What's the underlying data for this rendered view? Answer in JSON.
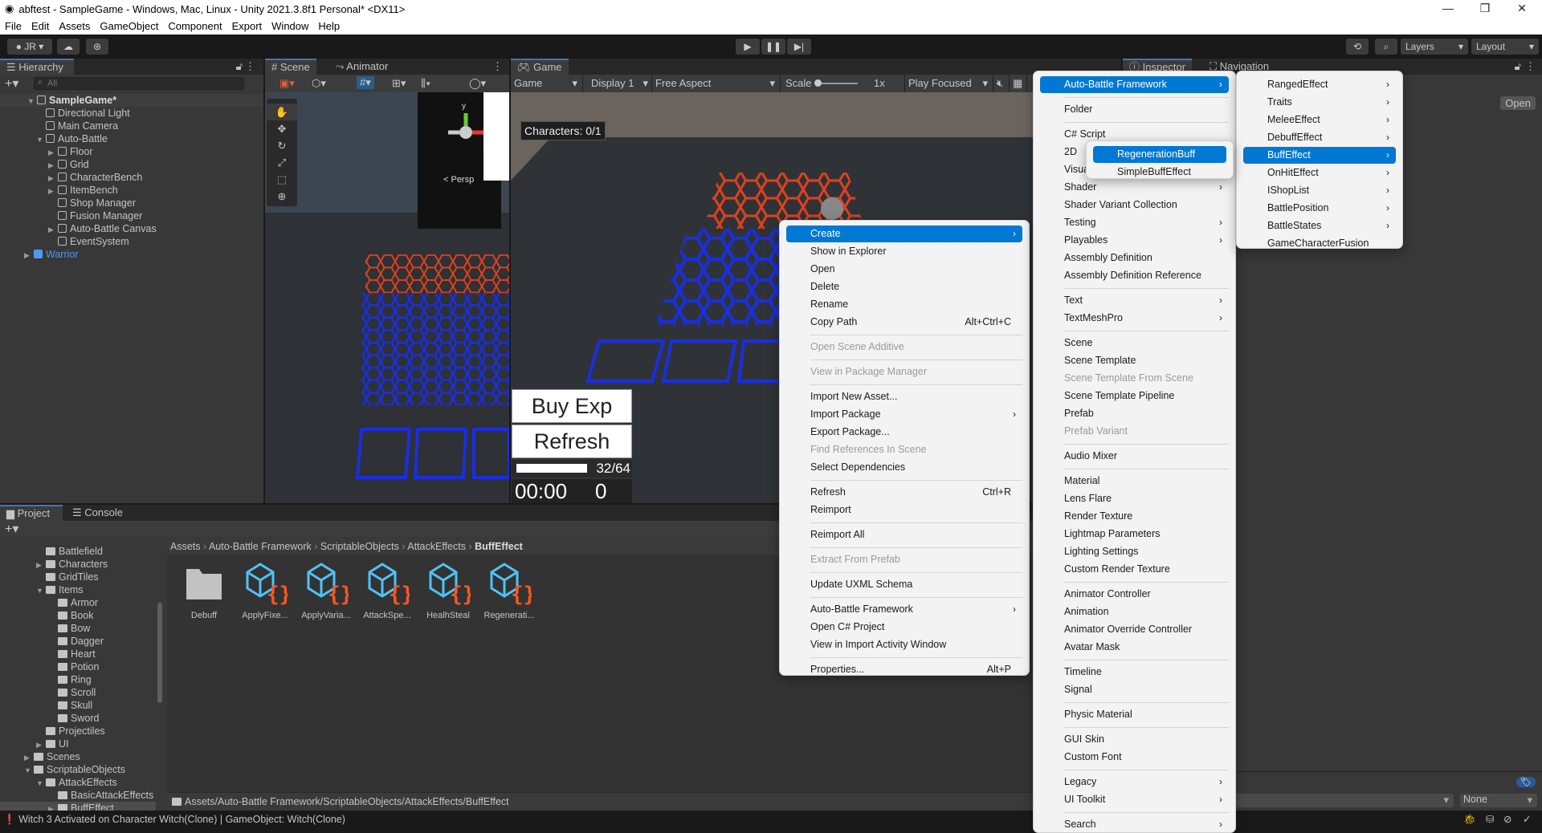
{
  "window": {
    "title": "abftest - SampleGame - Windows, Mac, Linux - Unity 2021.3.8f1 Personal* <DX11>"
  },
  "menubar": [
    "File",
    "Edit",
    "Assets",
    "GameObject",
    "Component",
    "Export",
    "Window",
    "Help"
  ],
  "toolbar": {
    "account": "JR",
    "layers": "Layers",
    "layout": "Layout"
  },
  "hierarchy": {
    "tab": "Hierarchy",
    "search_placeholder": "All",
    "items": [
      {
        "label": "SampleGame*",
        "depth": 0,
        "expanded": true,
        "type": "scene"
      },
      {
        "label": "Directional Light",
        "depth": 1,
        "type": "object"
      },
      {
        "label": "Main Camera",
        "depth": 1,
        "type": "object"
      },
      {
        "label": "Auto-Battle",
        "depth": 1,
        "expanded": true,
        "type": "object"
      },
      {
        "label": "Floor",
        "depth": 2,
        "collapsed": true,
        "type": "object"
      },
      {
        "label": "Grid",
        "depth": 2,
        "collapsed": true,
        "type": "object"
      },
      {
        "label": "CharacterBench",
        "depth": 2,
        "collapsed": true,
        "type": "object"
      },
      {
        "label": "ItemBench",
        "depth": 2,
        "collapsed": true,
        "type": "object"
      },
      {
        "label": "Shop Manager",
        "depth": 2,
        "type": "object"
      },
      {
        "label": "Fusion Manager",
        "depth": 2,
        "type": "object"
      },
      {
        "label": "Auto-Battle Canvas",
        "depth": 2,
        "collapsed": true,
        "type": "object"
      },
      {
        "label": "EventSystem",
        "depth": 2,
        "type": "object"
      },
      {
        "label": "Warrior",
        "depth": 0,
        "collapsed": true,
        "type": "prefab"
      }
    ]
  },
  "scene": {
    "tab_scene": "Scene",
    "tab_animator": "Animator",
    "persp": "< Persp",
    "axis_y": "y"
  },
  "game": {
    "tab": "Game",
    "mode": "Game",
    "display": "Display 1",
    "aspect": "Free Aspect",
    "scale_label": "Scale",
    "scale_value": "1x",
    "play_mode": "Play Focused",
    "characters": "Characters: 0/1",
    "buy_exp": "Buy Exp",
    "refresh": "Refresh",
    "exp_text": "32/64",
    "exp_fraction": 0.5,
    "timer": "00:00",
    "gold": "0"
  },
  "inspector": {
    "tab_inspector": "Inspector",
    "tab_navigation": "Navigation",
    "open": "Open",
    "none": "None"
  },
  "project": {
    "tab_project": "Project",
    "tab_console": "Console",
    "tree": [
      {
        "label": "Battlefield",
        "depth": 2
      },
      {
        "label": "Characters",
        "depth": 2,
        "collapsed": true
      },
      {
        "label": "GridTiles",
        "depth": 2
      },
      {
        "label": "Items",
        "depth": 2,
        "expanded": true
      },
      {
        "label": "Armor",
        "depth": 3
      },
      {
        "label": "Book",
        "depth": 3
      },
      {
        "label": "Bow",
        "depth": 3
      },
      {
        "label": "Dagger",
        "depth": 3
      },
      {
        "label": "Heart",
        "depth": 3
      },
      {
        "label": "Potion",
        "depth": 3
      },
      {
        "label": "Ring",
        "depth": 3
      },
      {
        "label": "Scroll",
        "depth": 3
      },
      {
        "label": "Skull",
        "depth": 3
      },
      {
        "label": "Sword",
        "depth": 3
      },
      {
        "label": "Projectiles",
        "depth": 2
      },
      {
        "label": "UI",
        "depth": 2,
        "collapsed": true
      },
      {
        "label": "Scenes",
        "depth": 1,
        "collapsed": true
      },
      {
        "label": "ScriptableObjects",
        "depth": 1,
        "expanded": true
      },
      {
        "label": "AttackEffects",
        "depth": 2,
        "expanded": true
      },
      {
        "label": "BasicAttackEffects",
        "depth": 3
      },
      {
        "label": "BuffEffect",
        "depth": 3,
        "collapsed": true,
        "selected": true
      }
    ],
    "breadcrumb": [
      "Assets",
      "Auto-Battle Framework",
      "ScriptableObjects",
      "AttackEffects",
      "BuffEffect"
    ],
    "assets": [
      {
        "label": "Debuff",
        "type": "folder"
      },
      {
        "label": "ApplyFixe...",
        "type": "script-asset"
      },
      {
        "label": "ApplyVaria...",
        "type": "script-asset"
      },
      {
        "label": "AttackSpe...",
        "type": "script-asset"
      },
      {
        "label": "HealhSteal",
        "type": "script-asset"
      },
      {
        "label": "Regenerati...",
        "type": "script-asset"
      }
    ],
    "path": "Assets/Auto-Battle Framework/ScriptableObjects/AttackEffects/BuffEffect"
  },
  "status": {
    "message": "Witch 3 Activated on Character Witch(Clone) | GameObject: Witch(Clone)"
  },
  "context_menu": [
    {
      "label": "Create",
      "sub": true,
      "hl": true
    },
    {
      "label": "Show in Explorer"
    },
    {
      "label": "Open"
    },
    {
      "label": "Delete"
    },
    {
      "label": "Rename"
    },
    {
      "label": "Copy Path",
      "shortcut": "Alt+Ctrl+C"
    },
    {
      "sep": true
    },
    {
      "label": "Open Scene Additive",
      "disabled": true
    },
    {
      "sep": true
    },
    {
      "label": "View in Package Manager",
      "disabled": true
    },
    {
      "sep": true
    },
    {
      "label": "Import New Asset..."
    },
    {
      "label": "Import Package",
      "sub": true
    },
    {
      "label": "Export Package..."
    },
    {
      "label": "Find References In Scene",
      "disabled": true
    },
    {
      "label": "Select Dependencies"
    },
    {
      "sep": true
    },
    {
      "label": "Refresh",
      "shortcut": "Ctrl+R"
    },
    {
      "label": "Reimport"
    },
    {
      "sep": true
    },
    {
      "label": "Reimport All"
    },
    {
      "sep": true
    },
    {
      "label": "Extract From Prefab",
      "disabled": true
    },
    {
      "sep": true
    },
    {
      "label": "Update UXML Schema"
    },
    {
      "sep": true
    },
    {
      "label": "Auto-Battle Framework",
      "sub": true
    },
    {
      "label": "Open C# Project"
    },
    {
      "label": "View in Import Activity Window"
    },
    {
      "sep": true
    },
    {
      "label": "Properties...",
      "shortcut": "Alt+P"
    }
  ],
  "create_menu": [
    {
      "label": "Auto-Battle Framework",
      "sub": true,
      "hl": true
    },
    {
      "sep": true
    },
    {
      "label": "Folder"
    },
    {
      "sep": true
    },
    {
      "label": "C# Script"
    },
    {
      "label": "2D",
      "sub": true
    },
    {
      "label": "Visual Scripting",
      "sub": true
    },
    {
      "label": "Shader",
      "sub": true
    },
    {
      "label": "Shader Variant Collection"
    },
    {
      "label": "Testing",
      "sub": true
    },
    {
      "label": "Playables",
      "sub": true
    },
    {
      "label": "Assembly Definition"
    },
    {
      "label": "Assembly Definition Reference"
    },
    {
      "sep": true
    },
    {
      "label": "Text",
      "sub": true
    },
    {
      "label": "TextMeshPro",
      "sub": true
    },
    {
      "sep": true
    },
    {
      "label": "Scene"
    },
    {
      "label": "Scene Template"
    },
    {
      "label": "Scene Template From Scene",
      "disabled": true
    },
    {
      "label": "Scene Template Pipeline"
    },
    {
      "label": "Prefab"
    },
    {
      "label": "Prefab Variant",
      "disabled": true
    },
    {
      "sep": true
    },
    {
      "label": "Audio Mixer"
    },
    {
      "sep": true
    },
    {
      "label": "Material"
    },
    {
      "label": "Lens Flare"
    },
    {
      "label": "Render Texture"
    },
    {
      "label": "Lightmap Parameters"
    },
    {
      "label": "Lighting Settings"
    },
    {
      "label": "Custom Render Texture"
    },
    {
      "sep": true
    },
    {
      "label": "Animator Controller"
    },
    {
      "label": "Animation"
    },
    {
      "label": "Animator Override Controller"
    },
    {
      "label": "Avatar Mask"
    },
    {
      "sep": true
    },
    {
      "label": "Timeline"
    },
    {
      "label": "Signal"
    },
    {
      "sep": true
    },
    {
      "label": "Physic Material"
    },
    {
      "sep": true
    },
    {
      "label": "GUI Skin"
    },
    {
      "label": "Custom Font"
    },
    {
      "sep": true
    },
    {
      "label": "Legacy",
      "sub": true
    },
    {
      "label": "UI Toolkit",
      "sub": true
    },
    {
      "sep": true
    },
    {
      "label": "Search",
      "sub": true
    }
  ],
  "abf_menu": [
    {
      "label": "RangedEffect",
      "sub": true
    },
    {
      "label": "Traits",
      "sub": true
    },
    {
      "label": "MeleeEffect",
      "sub": true
    },
    {
      "label": "DebuffEffect",
      "sub": true
    },
    {
      "label": "BuffEffect",
      "sub": true,
      "hl": true
    },
    {
      "label": "OnHitEffect",
      "sub": true
    },
    {
      "label": "IShopList",
      "sub": true
    },
    {
      "label": "BattlePosition",
      "sub": true
    },
    {
      "label": "BattleStates",
      "sub": true
    },
    {
      "label": "GameCharacterFusion"
    }
  ],
  "buff_menu": [
    {
      "label": "RegenerationBuff",
      "hl": true
    },
    {
      "label": "SimpleBuffEffect"
    }
  ],
  "colors": {
    "accent": "#0078d4",
    "selection": "#2c5d87",
    "prefab": "#4b9cf0",
    "hex_red": "#e0401c",
    "hex_blue": "#1a2ee0"
  }
}
